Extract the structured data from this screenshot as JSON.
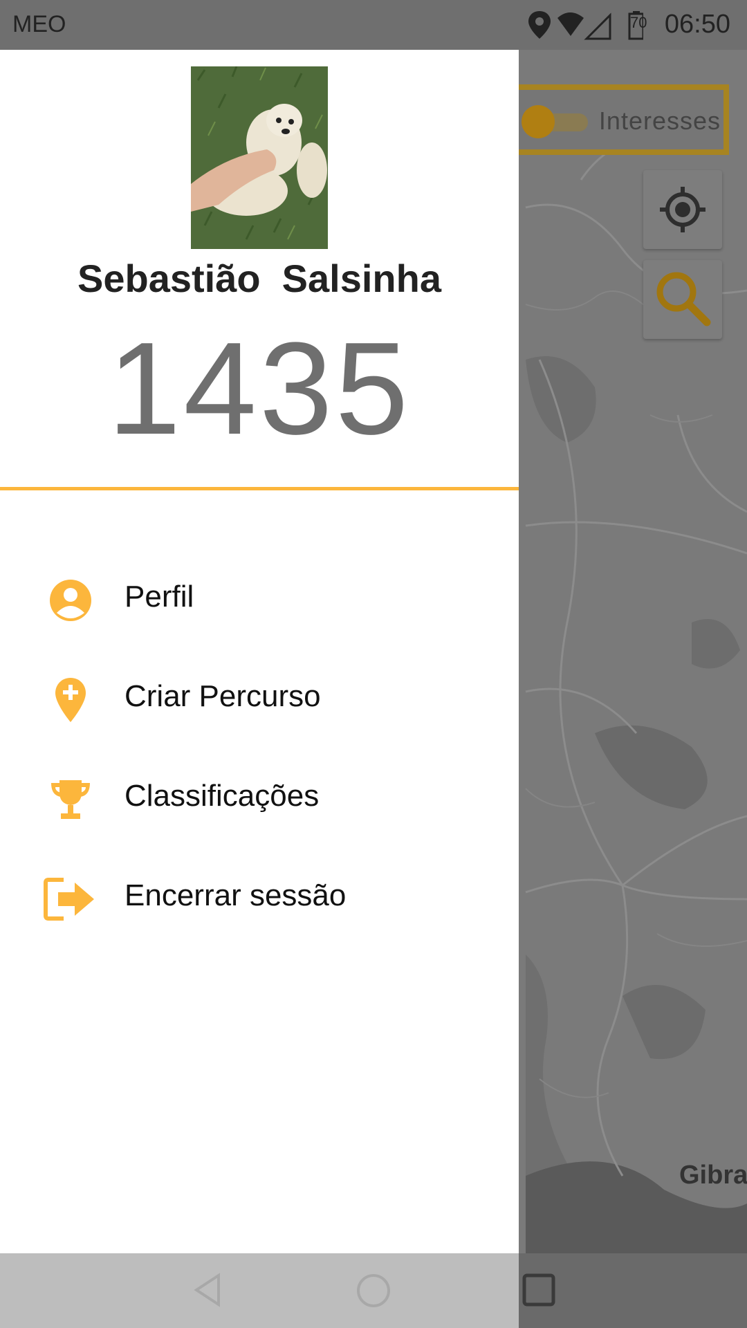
{
  "status_bar": {
    "carrier": "MEO",
    "battery": "70",
    "time": "06:50"
  },
  "map": {
    "toggle_label": "Interesses",
    "place_label": "Gibra"
  },
  "drawer": {
    "user_name": "Sebastião  Salsinha",
    "score": "1435",
    "menu": [
      {
        "label": "Perfil",
        "icon": "account-circle-icon"
      },
      {
        "label": "Criar Percurso",
        "icon": "add-location-icon"
      },
      {
        "label": "Classificações",
        "icon": "trophy-icon"
      },
      {
        "label": "Encerrar sessão",
        "icon": "logout-icon"
      }
    ]
  },
  "colors": {
    "accent": "#fcb63c",
    "drawer_bg": "#ffffff",
    "score_text": "#6f6f6f"
  }
}
